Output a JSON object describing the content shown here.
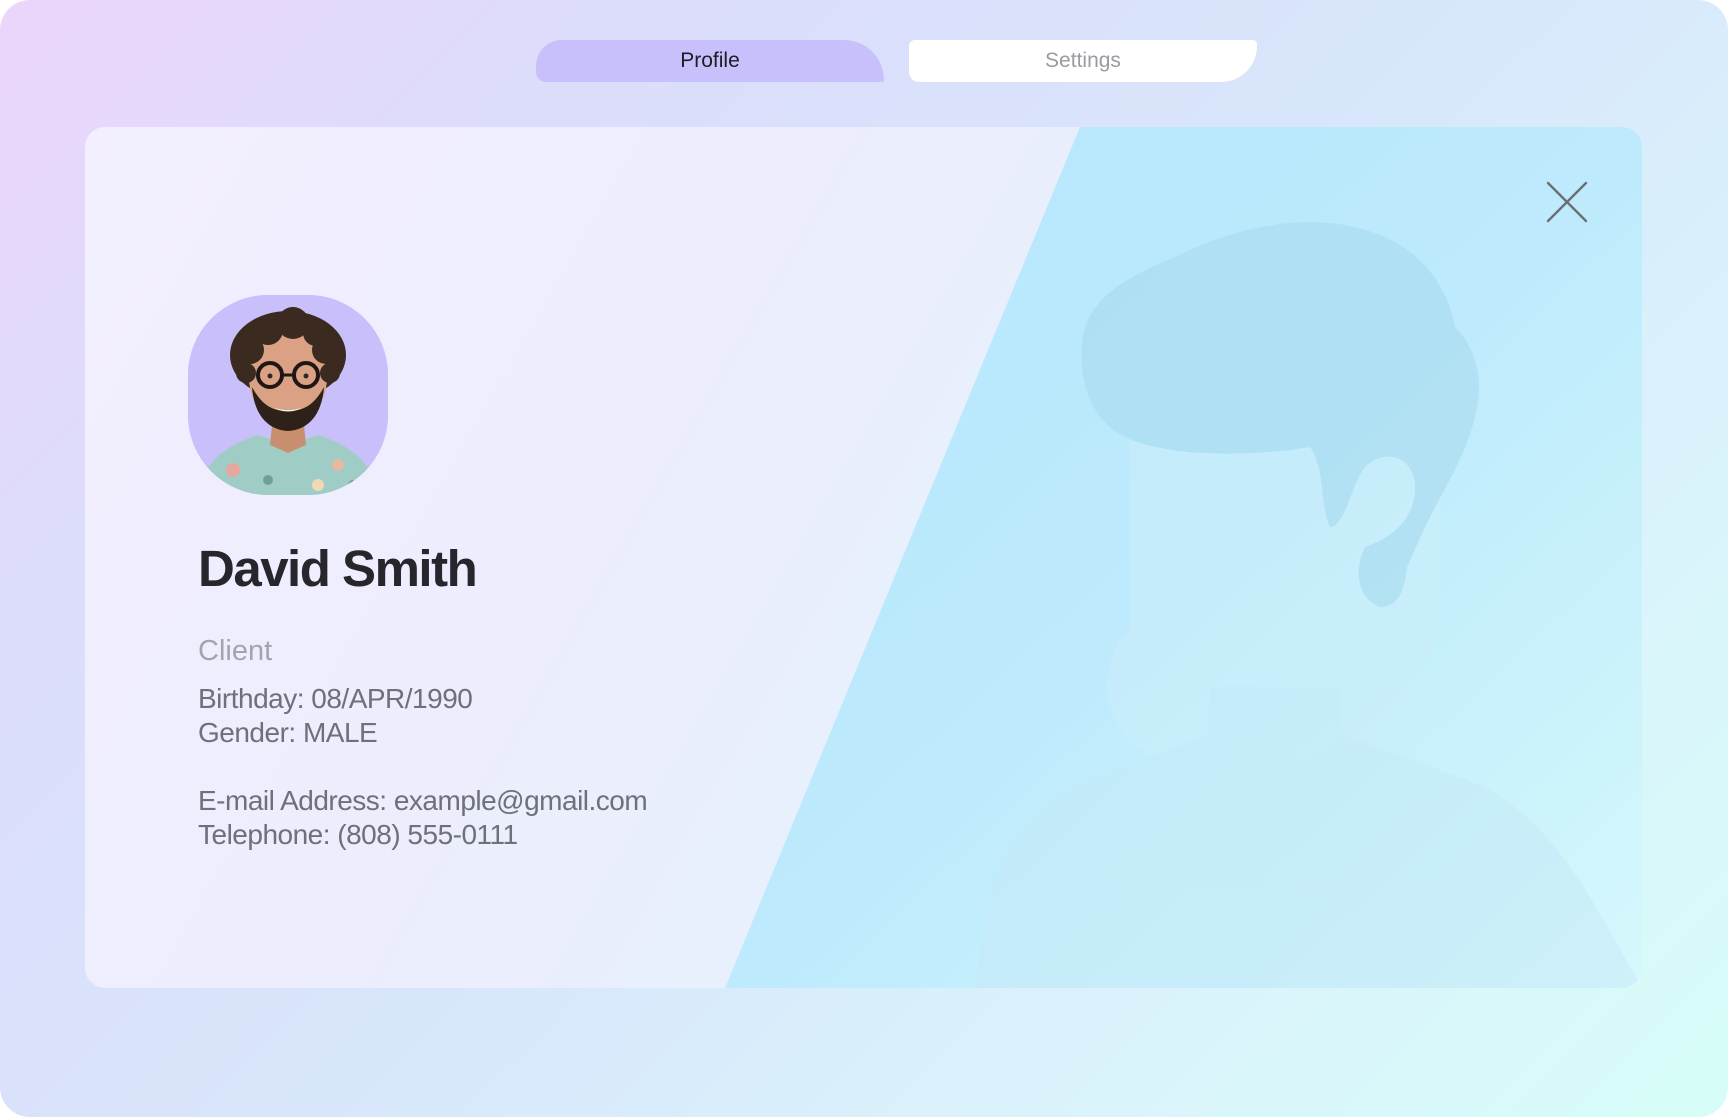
{
  "tabs": {
    "profile_label": "Profile",
    "settings_label": "Settings"
  },
  "profile": {
    "name": "David Smith",
    "role": "Client",
    "birthday": "Birthday: 08/APR/1990",
    "gender": "Gender: MALE",
    "email": "E-mail Address: example@gmail.com",
    "telephone": "Telephone: (808) 555-0111"
  },
  "icons": {
    "close": "close-icon",
    "avatar": "avatar-photo",
    "silhouette": "person-silhouette-icon"
  },
  "colors": {
    "active_tab": "#c8c0fb",
    "inactive_tab": "#ffffff",
    "avatar_background": "#c9bffb",
    "name_text": "#26262c",
    "role_text": "#a4a4ac",
    "info_text": "#6e707a"
  }
}
